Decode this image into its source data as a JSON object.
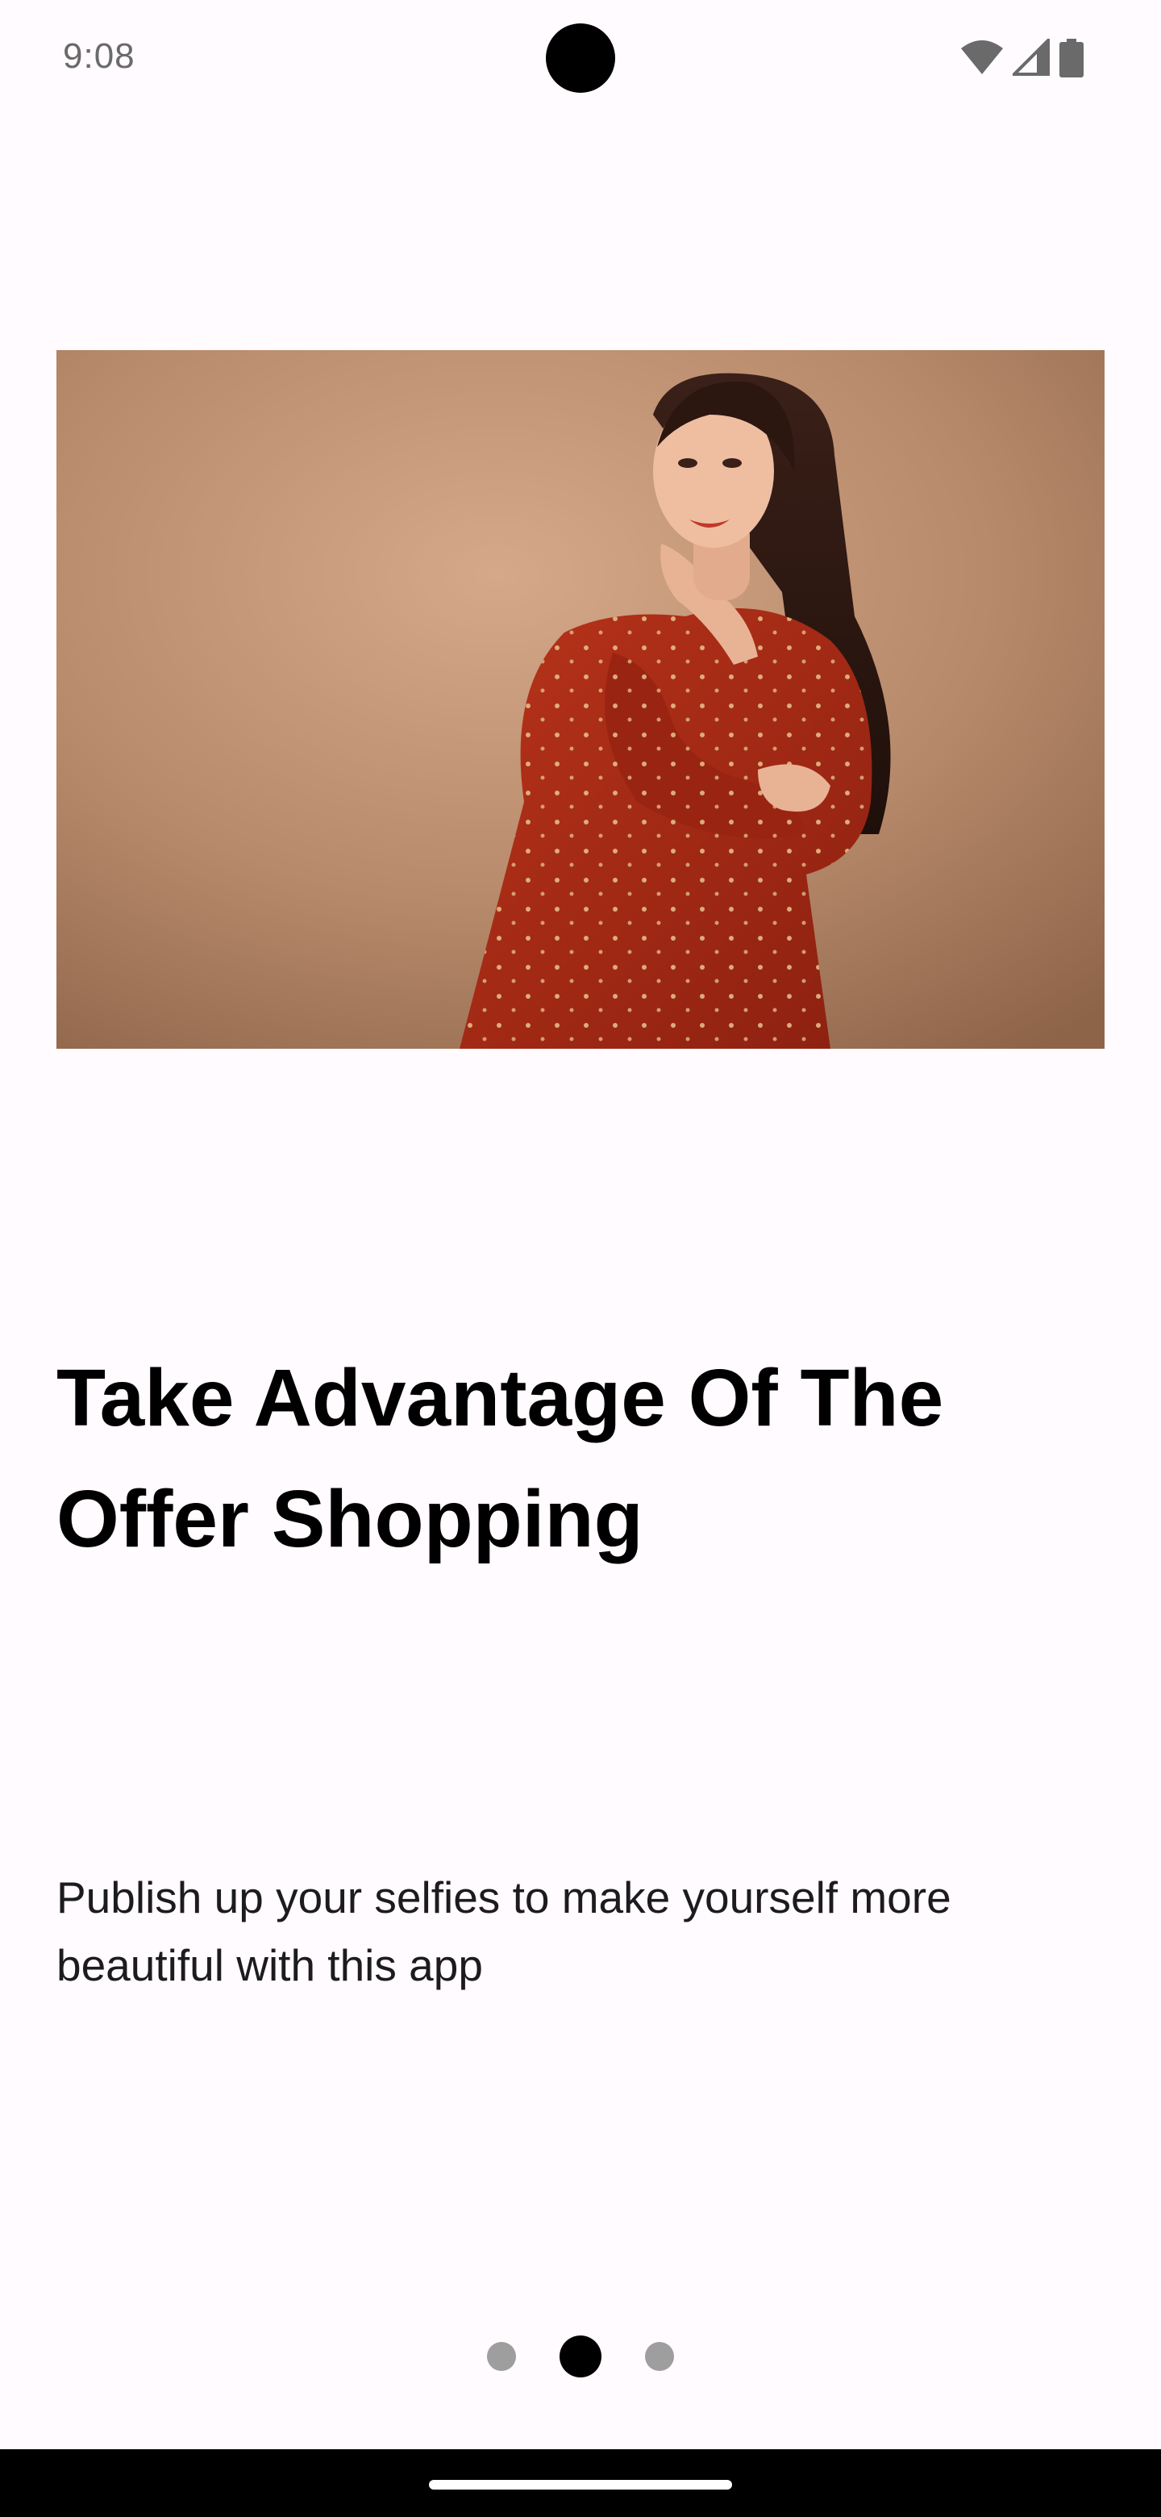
{
  "status_bar": {
    "time": "9:08",
    "icons": [
      "wifi-icon",
      "cellular-signal-icon",
      "battery-icon"
    ]
  },
  "onboarding": {
    "hero_image": "woman-in-red-dress-photo",
    "title": "Take Advantage Of The Offer Shopping",
    "description": "Publish up your selfies to make yourself more beautiful with this app",
    "page_indicator": {
      "total_pages": 3,
      "current_page": 2
    }
  },
  "colors": {
    "background": "#fffbfe",
    "title_text": "#000000",
    "body_text": "#1c1b1f",
    "active_dot": "#000000",
    "inactive_dot": "#9e9e9e",
    "photo_background": "#b48566",
    "dress": "#a52a14"
  }
}
